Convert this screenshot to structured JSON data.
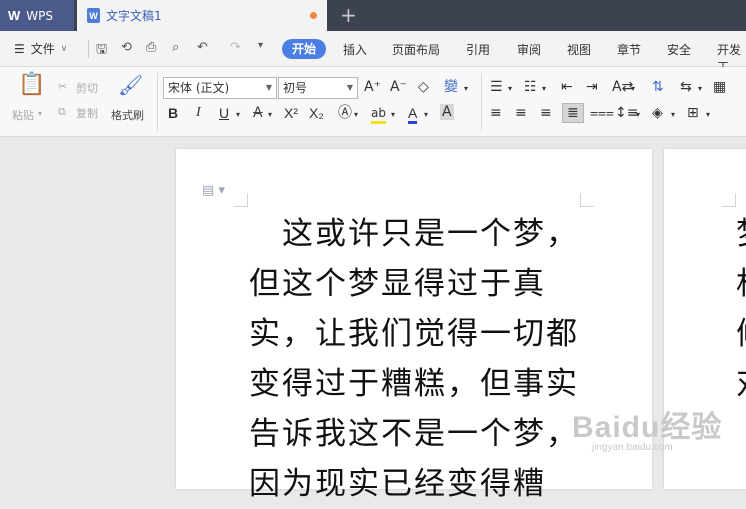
{
  "tabs": {
    "app": "WPS",
    "document": "文字文稿1",
    "app_icon": "wps-logo-icon",
    "doc_icon": "writer-doc-icon",
    "new_tab": "+"
  },
  "menu": {
    "file": "文件",
    "items": [
      "开始",
      "插入",
      "页面布局",
      "引用",
      "审阅",
      "视图",
      "章节",
      "安全",
      "开发工"
    ],
    "active": "开始",
    "accent_color": "#4b7ee3"
  },
  "ribbon": {
    "paste": "粘贴",
    "cut": "剪切",
    "copy": "复制",
    "format_painter": "格式刷",
    "font_name": "宋体 (正文)",
    "font_size": "初号",
    "bold": "B",
    "italic": "I",
    "underline": "U",
    "font_color_letter": "A",
    "superscript": "X²",
    "subscript": "X₂"
  },
  "document": {
    "lines": [
      "　这或许只是一个梦，",
      "但这个梦显得过于真",
      "实，让我们觉得一切都",
      "变得过于糟糕，但事实",
      "告诉我这不是一个梦，",
      "因为现实已经变得糟"
    ],
    "page2_lines": [
      "梦",
      "相",
      "候",
      "对"
    ]
  },
  "watermark": {
    "brand": "Baidu经验",
    "url": "jingyan.baidu.com"
  }
}
